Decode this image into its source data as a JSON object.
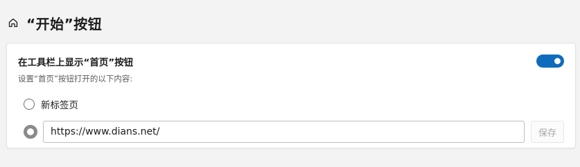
{
  "header": {
    "title": "“开始”按钮",
    "icon": "home-icon"
  },
  "setting": {
    "title": "在工具栏上显示“首页”按钮",
    "description": "设置“首页”按钮打开的以下内容:",
    "toggle_on": true,
    "accent_color": "#0f6cbd"
  },
  "options": {
    "new_tab_label": "新标签页",
    "new_tab_selected": false,
    "custom_url_selected": true,
    "custom_url_value": "https://www.dians.net/"
  },
  "save_button": {
    "label": "保存",
    "enabled": false
  }
}
